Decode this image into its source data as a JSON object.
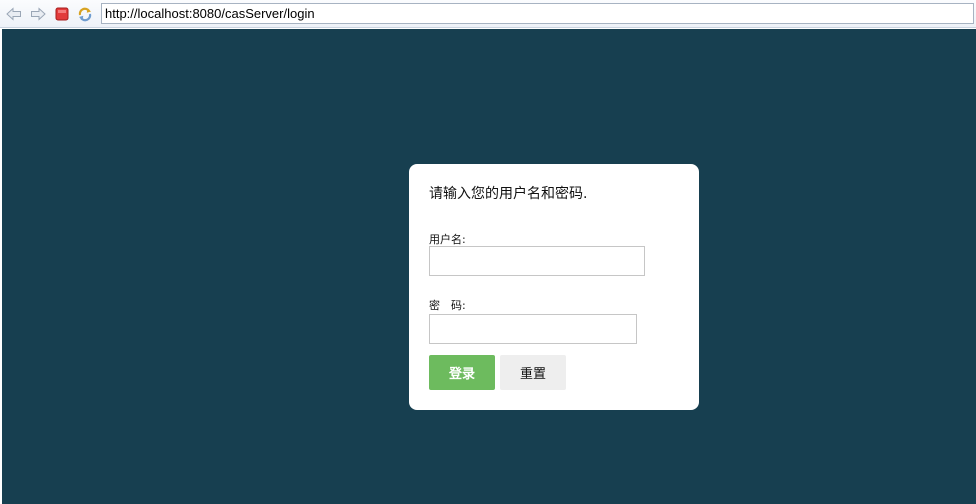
{
  "browser": {
    "url": "http://localhost:8080/casServer/login",
    "icons": [
      "back-arrow-icon",
      "forward-arrow-icon",
      "stop-icon",
      "refresh-icon"
    ]
  },
  "login": {
    "prompt": "请输入您的用户名和密码.",
    "username_label": "用户名:",
    "password_label": "密　码:",
    "username_value": "",
    "password_value": "",
    "login_button": "登录",
    "reset_button": "重置"
  },
  "colors": {
    "page_background": "#173f50",
    "card_background": "#ffffff",
    "login_button": "#6dbb5e",
    "reset_button": "#eeeeee"
  }
}
